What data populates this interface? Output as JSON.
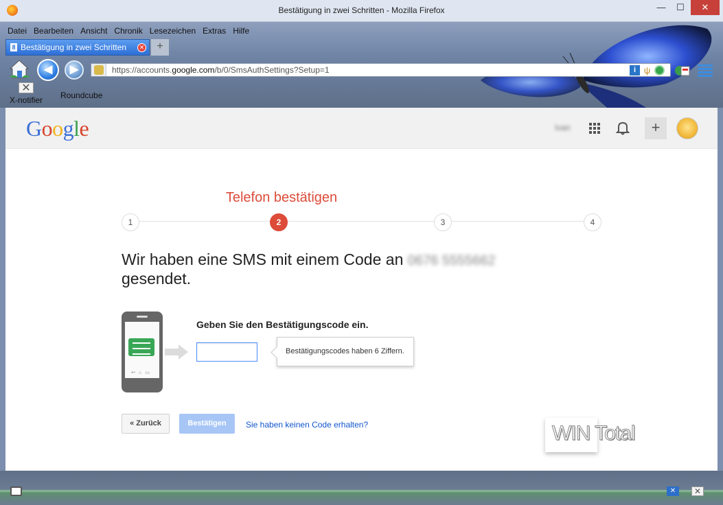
{
  "window": {
    "title": "Bestätigung in zwei Schritten - Mozilla Firefox",
    "min": "—",
    "max": "☐",
    "close": "✕"
  },
  "menu": [
    "Datei",
    "Bearbeiten",
    "Ansicht",
    "Chronik",
    "Lesezeichen",
    "Extras",
    "Hilfe"
  ],
  "tab": {
    "label": "Bestätigung in zwei Schritten",
    "favicon": "8",
    "new_tab": "+"
  },
  "nav": {
    "url_prefix": "https://accounts.",
    "url_domain": "google.com",
    "url_path": "/b/0/SmsAuthSettings?Setup=1"
  },
  "bookmarks": {
    "xnotifier": "X-notifier",
    "roundcube": "Roundcube"
  },
  "google_header": {
    "logo": [
      {
        "ch": "G",
        "color": "#3b6fd6"
      },
      {
        "ch": "o",
        "color": "#d8432d"
      },
      {
        "ch": "o",
        "color": "#f2b21b"
      },
      {
        "ch": "g",
        "color": "#3b6fd6"
      },
      {
        "ch": "l",
        "color": "#3ba24f"
      },
      {
        "ch": "e",
        "color": "#d8432d"
      }
    ],
    "username": "Ivan",
    "plus": "+"
  },
  "steps": {
    "title": "Telefon bestätigen",
    "items": [
      "1",
      "2",
      "3",
      "4"
    ],
    "active": 2
  },
  "message": {
    "text": "Wir haben eine SMS mit einem Code an ",
    "number": "0676 5555662",
    "text2": "gesendet."
  },
  "form": {
    "label": "Geben Sie den Bestätigungscode ein.",
    "code_value": "",
    "tooltip": "Bestätigungscodes haben 6 Ziffern."
  },
  "buttons": {
    "back": "« Zurück",
    "confirm": "Bestätigen",
    "no_code": "Sie haben keinen Code erhalten?"
  },
  "watermark": "WIN Total",
  "colors": {
    "accent_red": "#dd4b39",
    "link_blue": "#1155cc",
    "confirm_disabled": "#a7c6f6",
    "input_focus": "#4d90fe"
  }
}
